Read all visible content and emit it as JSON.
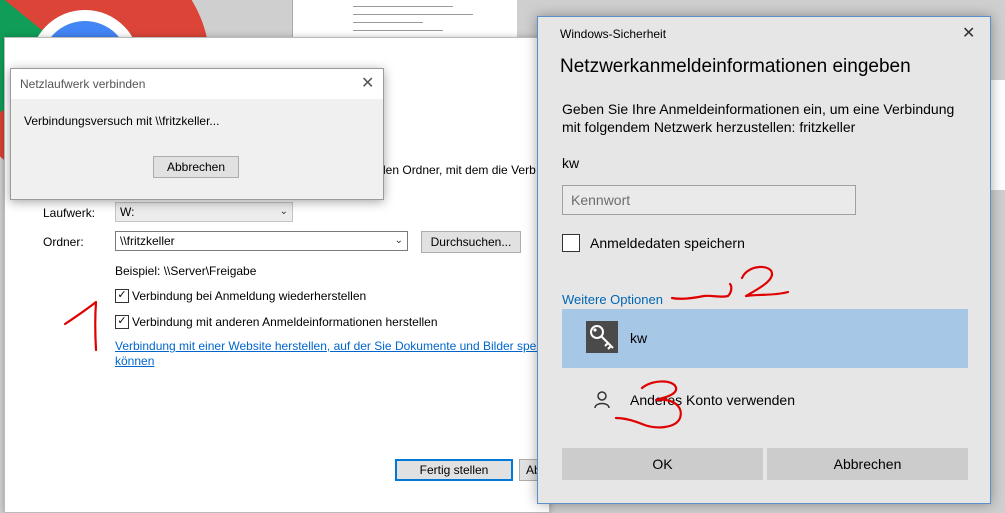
{
  "small_dialog": {
    "title": "Netzlaufwerk verbinden",
    "message": "Verbindungsversuch mit \\\\fritzkeller...",
    "cancel_label": "Abbrechen"
  },
  "wizard": {
    "heading_partial": "?",
    "intro_partial": "den Ordner, mit dem die Verb",
    "drive_label": "Laufwerk:",
    "drive_value": "W:",
    "folder_label": "Ordner:",
    "folder_value": "\\\\fritzkeller",
    "browse_label": "Durchsuchen...",
    "example": "Beispiel: \\\\Server\\Freigabe",
    "reconnect_label": "Verbindung bei Anmeldung wiederherstellen",
    "reconnect_checked": true,
    "other_creds_label": "Verbindung mit anderen Anmeldeinformationen herstellen",
    "other_creds_checked": true,
    "website_link_line1": "Verbindung mit einer Website herstellen, auf der Sie Dokumente und Bilder speic",
    "website_link_line2": "können",
    "finish_label": "Fertig stellen",
    "cancel_partial": "Ab"
  },
  "security": {
    "window_title": "Windows-Sicherheit",
    "heading": "Netzwerkanmeldeinformationen eingeben",
    "description_line1": "Geben Sie Ihre Anmeldeinformationen ein, um eine Verbindung",
    "description_line2": "mit folgendem Netzwerk herzustellen: fritzkeller",
    "username": "kw",
    "password_placeholder": "Kennwort",
    "remember_label": "Anmeldedaten speichern",
    "remember_checked": false,
    "more_options": "Weitere Optionen",
    "account_name": "kw",
    "other_account": "Anderes Konto verwenden",
    "ok_label": "OK",
    "cancel_label": "Abbrechen"
  },
  "annotations": {
    "mark_1": "1",
    "mark_2": "2",
    "mark_3": "3"
  },
  "colors": {
    "accent": "#0078d7",
    "link": "#0066cc",
    "selected_account": "#a7c7e7",
    "annotation": "#e00000"
  }
}
